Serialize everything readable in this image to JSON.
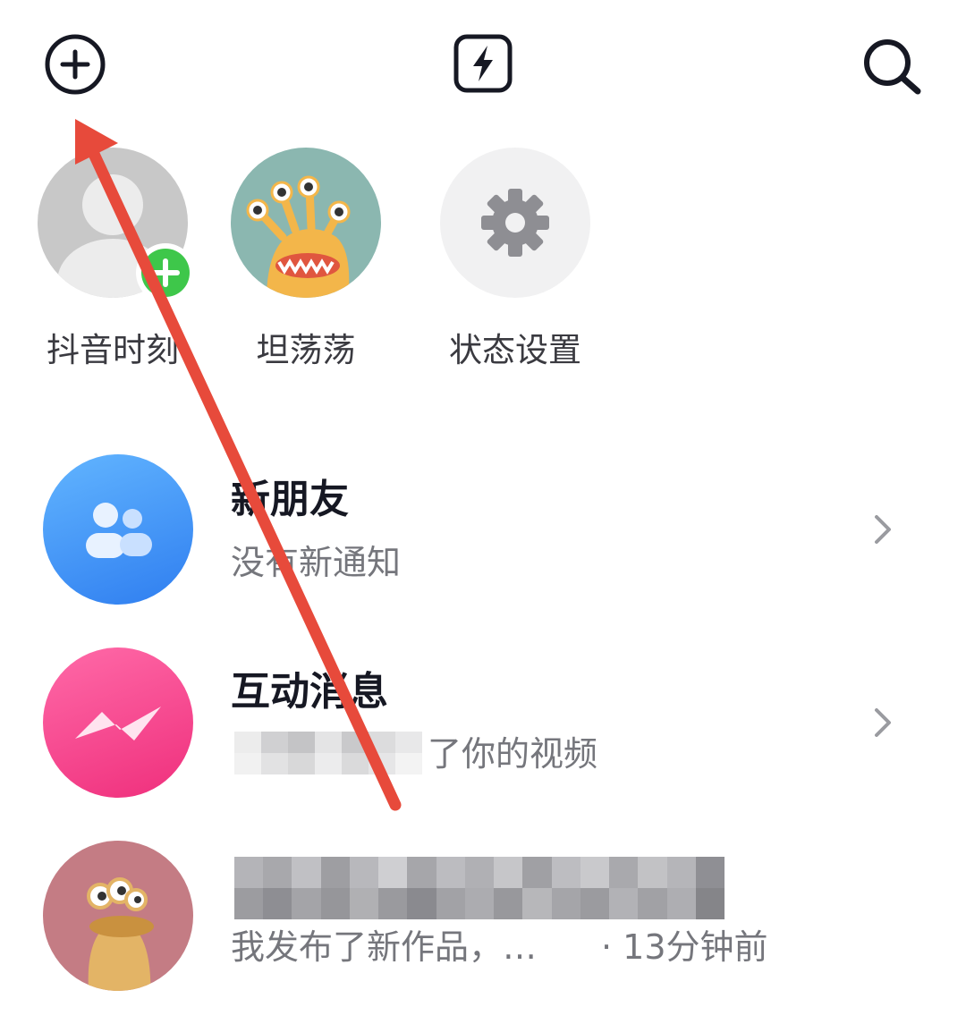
{
  "header": {
    "add_icon": "plus-circle-icon",
    "flash_icon": "lightning-icon",
    "search_icon": "search-icon"
  },
  "stories": [
    {
      "label": "抖音时刻",
      "icon": "default-avatar-icon",
      "badge_icon": "green-plus-icon"
    },
    {
      "label": "坦荡荡",
      "icon": "monster-avatar"
    },
    {
      "label": "状态设置",
      "icon": "gear-icon"
    }
  ],
  "messages": [
    {
      "title": "新朋友",
      "subtitle": "没有新通知",
      "icon": "friends-icon",
      "chevron_icon": "chevron-right-icon"
    },
    {
      "title": "互动消息",
      "subtitle": "了你的视频",
      "icon": "interaction-icon",
      "chevron_icon": "chevron-right-icon"
    },
    {
      "title": "",
      "subtitle": "我发布了新作品，…",
      "time": "· 13分钟前",
      "icon": "monster-avatar-2"
    }
  ],
  "colors": {
    "friends_blue": "#3d8ef5",
    "interaction_pink": "#f53a87",
    "plus_green": "#3ec74a",
    "arrow_red": "#e74a3b"
  }
}
